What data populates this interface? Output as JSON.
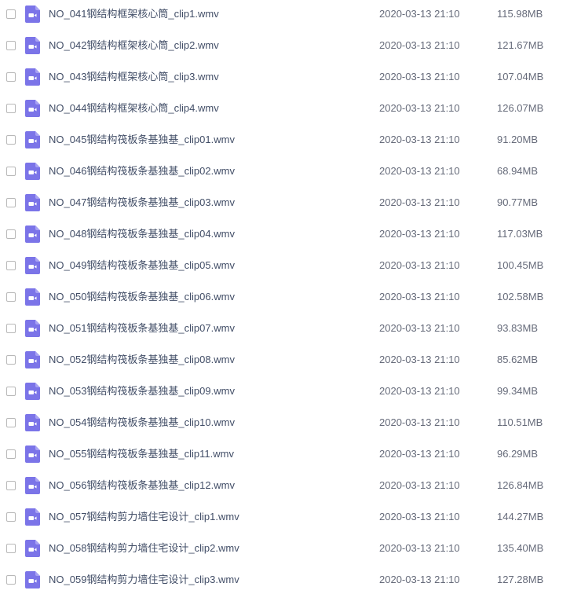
{
  "colors": {
    "video_icon": "#7b74e8",
    "video_icon_fold": "#a8a2f3",
    "name_text": "#424e67",
    "meta_text": "#666b7a",
    "checkbox_border": "#b8b8b8"
  },
  "icon": "video-file-icon",
  "files": [
    {
      "name": "NO_041钢结构框架核心筒_clip1.wmv",
      "date": "2020-03-13 21:10",
      "size": "115.98MB"
    },
    {
      "name": "NO_042钢结构框架核心筒_clip2.wmv",
      "date": "2020-03-13 21:10",
      "size": "121.67MB"
    },
    {
      "name": "NO_043钢结构框架核心筒_clip3.wmv",
      "date": "2020-03-13 21:10",
      "size": "107.04MB"
    },
    {
      "name": "NO_044钢结构框架核心筒_clip4.wmv",
      "date": "2020-03-13 21:10",
      "size": "126.07MB"
    },
    {
      "name": "NO_045钢结构筏板条基独基_clip01.wmv",
      "date": "2020-03-13 21:10",
      "size": "91.20MB"
    },
    {
      "name": "NO_046钢结构筏板条基独基_clip02.wmv",
      "date": "2020-03-13 21:10",
      "size": "68.94MB"
    },
    {
      "name": "NO_047钢结构筏板条基独基_clip03.wmv",
      "date": "2020-03-13 21:10",
      "size": "90.77MB"
    },
    {
      "name": "NO_048钢结构筏板条基独基_clip04.wmv",
      "date": "2020-03-13 21:10",
      "size": "117.03MB"
    },
    {
      "name": "NO_049钢结构筏板条基独基_clip05.wmv",
      "date": "2020-03-13 21:10",
      "size": "100.45MB"
    },
    {
      "name": "NO_050钢结构筏板条基独基_clip06.wmv",
      "date": "2020-03-13 21:10",
      "size": "102.58MB"
    },
    {
      "name": "NO_051钢结构筏板条基独基_clip07.wmv",
      "date": "2020-03-13 21:10",
      "size": "93.83MB"
    },
    {
      "name": "NO_052钢结构筏板条基独基_clip08.wmv",
      "date": "2020-03-13 21:10",
      "size": "85.62MB"
    },
    {
      "name": "NO_053钢结构筏板条基独基_clip09.wmv",
      "date": "2020-03-13 21:10",
      "size": "99.34MB"
    },
    {
      "name": "NO_054钢结构筏板条基独基_clip10.wmv",
      "date": "2020-03-13 21:10",
      "size": "110.51MB"
    },
    {
      "name": "NO_055钢结构筏板条基独基_clip11.wmv",
      "date": "2020-03-13 21:10",
      "size": "96.29MB"
    },
    {
      "name": "NO_056钢结构筏板条基独基_clip12.wmv",
      "date": "2020-03-13 21:10",
      "size": "126.84MB"
    },
    {
      "name": "NO_057钢结构剪力墙住宅设计_clip1.wmv",
      "date": "2020-03-13 21:10",
      "size": "144.27MB"
    },
    {
      "name": "NO_058钢结构剪力墙住宅设计_clip2.wmv",
      "date": "2020-03-13 21:10",
      "size": "135.40MB"
    },
    {
      "name": "NO_059钢结构剪力墙住宅设计_clip3.wmv",
      "date": "2020-03-13 21:10",
      "size": "127.28MB"
    }
  ]
}
